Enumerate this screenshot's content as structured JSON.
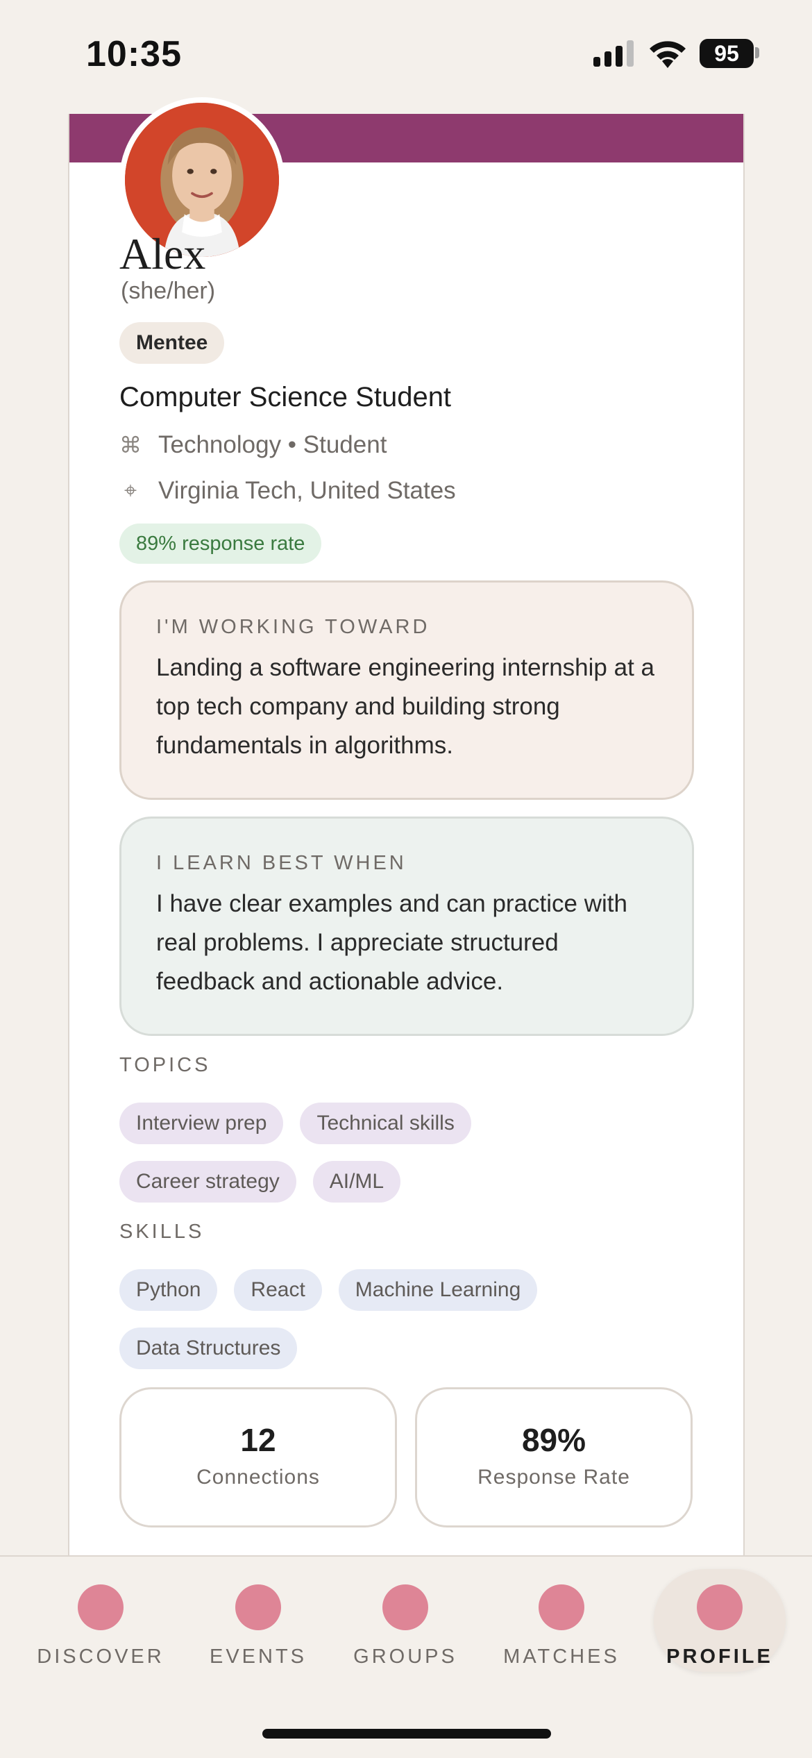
{
  "status_bar": {
    "time": "10:35",
    "battery": "95",
    "icons": [
      "signal-icon",
      "wifi-icon",
      "battery-icon"
    ]
  },
  "profile": {
    "banner_color": "#8E3A6E",
    "name": "Alex",
    "pronouns": "(she/her)",
    "role": "Mentee",
    "headline": "Computer Science Student",
    "industry": "Technology • Student",
    "industry_icon": "command-icon",
    "location": "Virginia Tech, United States",
    "location_icon": "crosshair-icon",
    "response_rate_badge": "89% response rate"
  },
  "goal": {
    "title": "I'M WORKING TOWARD",
    "text": "Landing a software engineering internship at a top tech company and building strong fundamentals in algorithms."
  },
  "learning": {
    "title": "I LEARN BEST WHEN",
    "text": "I have clear examples and can practice with real problems. I appreciate structured feedback and actionable advice."
  },
  "topics": {
    "title": "TOPICS",
    "items": [
      "Interview prep",
      "Technical skills",
      "Career strategy",
      "AI/ML"
    ]
  },
  "skills": {
    "title": "SKILLS",
    "items": [
      "Python",
      "React",
      "Machine Learning",
      "Data Structures"
    ]
  },
  "stats": [
    {
      "value": "12",
      "label": "Connections"
    },
    {
      "value": "89%",
      "label": "Response Rate"
    }
  ],
  "nav": {
    "accent_color": "#DE8596",
    "items": [
      {
        "label": "DISCOVER"
      },
      {
        "label": "EVENTS"
      },
      {
        "label": "GROUPS"
      },
      {
        "label": "MATCHES"
      },
      {
        "label": "PROFILE",
        "active": true
      }
    ]
  }
}
